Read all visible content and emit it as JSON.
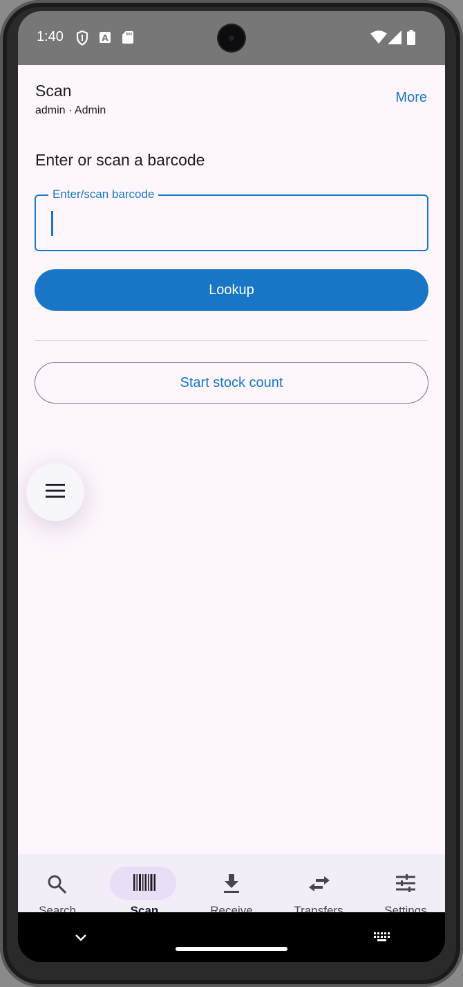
{
  "status_bar": {
    "time": "1:40",
    "left_icons": [
      "shield-icon",
      "keyboard-a-icon",
      "sd-card-icon"
    ],
    "right_icons": [
      "wifi-icon",
      "signal-icon",
      "battery-icon"
    ]
  },
  "header": {
    "title": "Scan",
    "subtitle": "admin · Admin",
    "more_label": "More"
  },
  "main": {
    "prompt": "Enter or scan a barcode",
    "barcode_field": {
      "label": "Enter/scan barcode",
      "value": ""
    },
    "lookup_label": "Lookup",
    "stock_count_label": "Start stock count"
  },
  "fab": {
    "icon": "menu-icon"
  },
  "bottom_nav": {
    "items": [
      {
        "label": "Search",
        "icon": "search-icon",
        "active": false
      },
      {
        "label": "Scan",
        "icon": "barcode-icon",
        "active": true
      },
      {
        "label": "Receive",
        "icon": "download-icon",
        "active": false
      },
      {
        "label": "Transfers",
        "icon": "swap-icon",
        "active": false
      },
      {
        "label": "Settings",
        "icon": "tune-icon",
        "active": false
      }
    ]
  },
  "colors": {
    "accent": "#1976c6",
    "background": "#fdf7fd",
    "nav_background": "#f3edf7",
    "nav_active_pill": "#e8def8",
    "status_bar": "#777777"
  }
}
